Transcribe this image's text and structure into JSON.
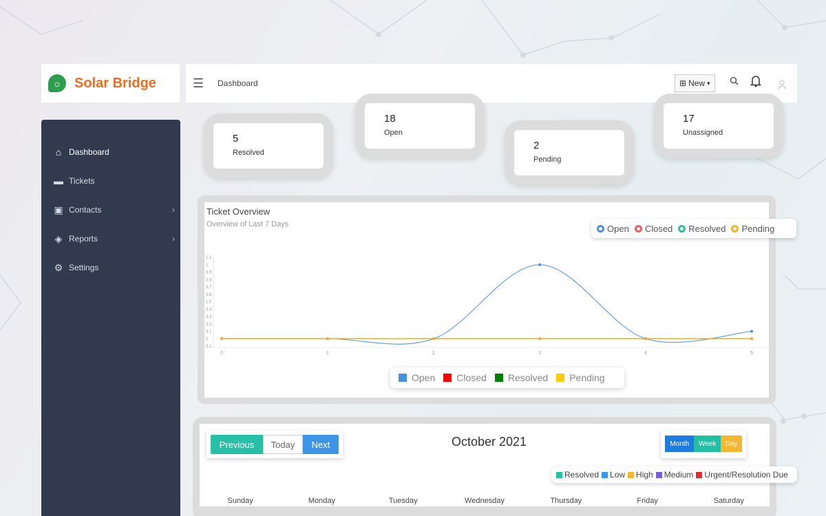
{
  "brand": {
    "name": "Solar Bridge"
  },
  "topbar": {
    "breadcrumb": "Dashboard",
    "new_label": "New"
  },
  "icons": {
    "menu": "hamburger-icon",
    "search": "search-icon",
    "notifications": "bell-icon",
    "user": "user-icon"
  },
  "sidebar": {
    "items": [
      {
        "label": "Dashboard",
        "icon": "home-icon",
        "active": true,
        "has_submenu": false
      },
      {
        "label": "Tickets",
        "icon": "ticket-icon",
        "active": false,
        "has_submenu": false
      },
      {
        "label": "Contacts",
        "icon": "contact-card-icon",
        "active": false,
        "has_submenu": true
      },
      {
        "label": "Reports",
        "icon": "layers-icon",
        "active": false,
        "has_submenu": true
      },
      {
        "label": "Settings",
        "icon": "gear-icon",
        "active": false,
        "has_submenu": false
      }
    ]
  },
  "stats": [
    {
      "value": "5",
      "label": "Resolved"
    },
    {
      "value": "18",
      "label": "Open"
    },
    {
      "value": "2",
      "label": "Pending"
    },
    {
      "value": "17",
      "label": "Unassigned"
    }
  ],
  "chart_data": {
    "type": "line",
    "title": "Ticket Overview",
    "subtitle": "Overview of Last 7 Days",
    "x": [
      0,
      1,
      2,
      3,
      4,
      5
    ],
    "y_tick_labels": [
      "1.1",
      "1",
      "3.9",
      "3.8",
      "3.7",
      "3.6",
      "1.5",
      "3.4",
      "3.3",
      "3.2",
      "3.1",
      "0",
      "3.1"
    ],
    "series": [
      {
        "name": "Open",
        "color": "#4a90e2",
        "values": [
          0,
          0,
          0,
          1,
          0,
          0.1
        ]
      },
      {
        "name": "Closed",
        "color": "#e8605e",
        "values": [
          0,
          0,
          0,
          0,
          0,
          0
        ]
      },
      {
        "name": "Resolved",
        "color": "#2bbfa4",
        "values": [
          0,
          0,
          0,
          0,
          0,
          0
        ]
      },
      {
        "name": "Pending",
        "color": "#f0b429",
        "values": [
          0,
          0,
          0,
          0,
          0,
          0
        ]
      }
    ],
    "legend_top": [
      "Open",
      "Closed",
      "Resolved",
      "Pending"
    ],
    "legend_bottom": [
      {
        "label": "Open",
        "color": "#4a90e2"
      },
      {
        "label": "Closed",
        "color": "#ff0000"
      },
      {
        "label": "Resolved",
        "color": "#008000"
      },
      {
        "label": "Pending",
        "color": "#ffcc00"
      }
    ]
  },
  "calendar": {
    "title": "October 2021",
    "buttons": {
      "previous": "Previous",
      "today": "Today",
      "next": "Next"
    },
    "views": {
      "month": "Month",
      "week": "Week",
      "day": "Day"
    },
    "legend": [
      {
        "label": "Resolved",
        "color": "#26c0a7"
      },
      {
        "label": "Low",
        "color": "#3d95e8"
      },
      {
        "label": "High",
        "color": "#f5b731"
      },
      {
        "label": "Medium",
        "color": "#7a5be8"
      },
      {
        "label": "Urgent/Resolution Due",
        "color": "#e8282d"
      }
    ],
    "weekdays": [
      "Sunday",
      "Monday",
      "Tuesday",
      "Wednesday",
      "Thursday",
      "Friday",
      "Saturday"
    ]
  }
}
